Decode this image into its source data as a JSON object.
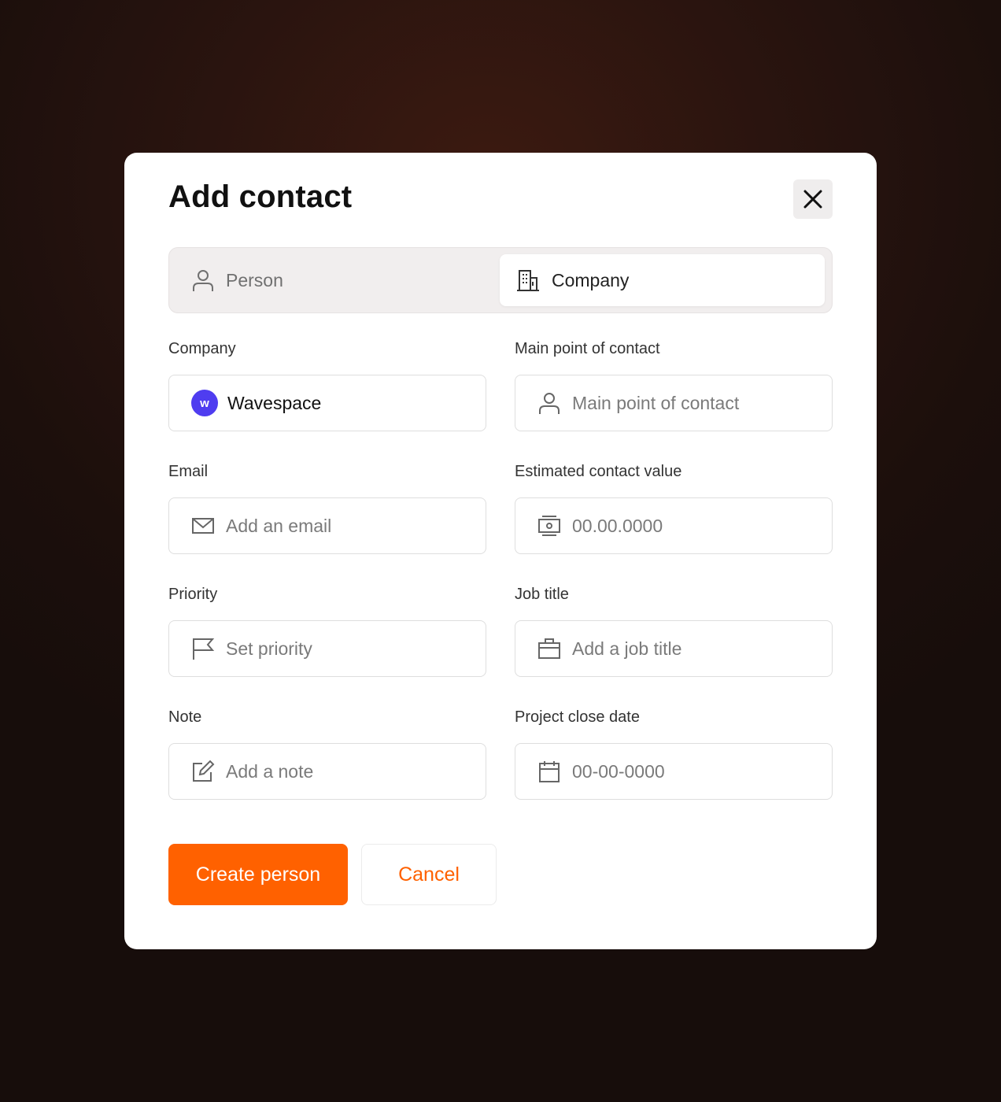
{
  "dialog": {
    "title": "Add contact",
    "close_icon": "close-icon"
  },
  "tabs": [
    {
      "label": "Person",
      "icon": "person-icon",
      "selected": false
    },
    {
      "label": "Company",
      "icon": "building-icon",
      "selected": true
    }
  ],
  "form": {
    "company": {
      "label": "Company",
      "value": "Wavespace",
      "logo_letter": "w",
      "logo_color": "#4f3df0"
    },
    "main_contact": {
      "label": "Main point of contact",
      "placeholder": "Main point of contact",
      "icon": "person-icon"
    },
    "email": {
      "label": "Email",
      "placeholder": "Add an email",
      "icon": "mail-icon"
    },
    "value": {
      "label": "Estimated contact value",
      "placeholder": "00.00.0000",
      "icon": "money-icon"
    },
    "priority": {
      "label": "Priority",
      "placeholder": "Set priority",
      "icon": "flag-icon"
    },
    "job_title": {
      "label": "Job title",
      "placeholder": "Add a job title",
      "icon": "briefcase-icon"
    },
    "note": {
      "label": "Note",
      "placeholder": "Add a note",
      "icon": "edit-note-icon"
    },
    "close_date": {
      "label": "Project close date",
      "placeholder": "00-00-0000",
      "icon": "calendar-icon"
    }
  },
  "actions": {
    "primary_label": "Create person",
    "secondary_label": "Cancel"
  },
  "colors": {
    "accent": "#ff6100",
    "brand_logo": "#4f3df0"
  }
}
